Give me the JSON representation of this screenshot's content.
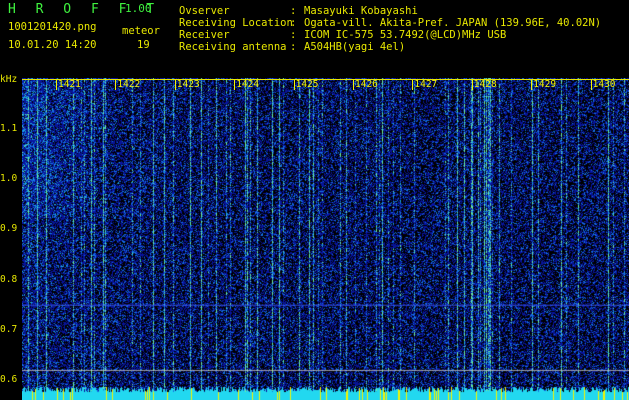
{
  "header": {
    "app_name": "H R O F F T",
    "version": "1.00",
    "filename": "1001201420.png",
    "datetime": "10.01.20 14:20",
    "meteor_label": "meteor",
    "meteor_count": "19"
  },
  "station": [
    {
      "label": "Ovserver",
      "value": "Masayuki Kobayashi"
    },
    {
      "label": "Receiving Location",
      "value": "Ogata-vill. Akita-Pref. JAPAN (139.96E, 40.02N)"
    },
    {
      "label": "Receiver",
      "value": "ICOM IC-575 53.7492(@LCD)MHz USB"
    },
    {
      "label": "Receiving antenna",
      "value": "A504HB(yagi 4el)"
    }
  ],
  "chart_data": {
    "type": "heatmap",
    "title": "",
    "ylabel": "kHz",
    "xlabel": "",
    "y_ticks": [
      1.1,
      1.0,
      0.9,
      0.8,
      0.7,
      0.6
    ],
    "ylim": [
      0.6,
      1.18
    ],
    "x_ticks": [
      "1421",
      "1422",
      "1423",
      "1424",
      "1425",
      "1426",
      "1427",
      "1428",
      "1429",
      "1430"
    ],
    "x_range_minutes": [
      "1420",
      "1430"
    ],
    "colors": {
      "background": "#000000",
      "noise_low": "#0a1a8c",
      "noise_mid": "#1c46e8",
      "noise_high": "#22c8e0",
      "peak": "#6af0a0",
      "marker": "#f5f500"
    },
    "horizontal_line_khz": [
      0.75,
      0.62
    ]
  }
}
